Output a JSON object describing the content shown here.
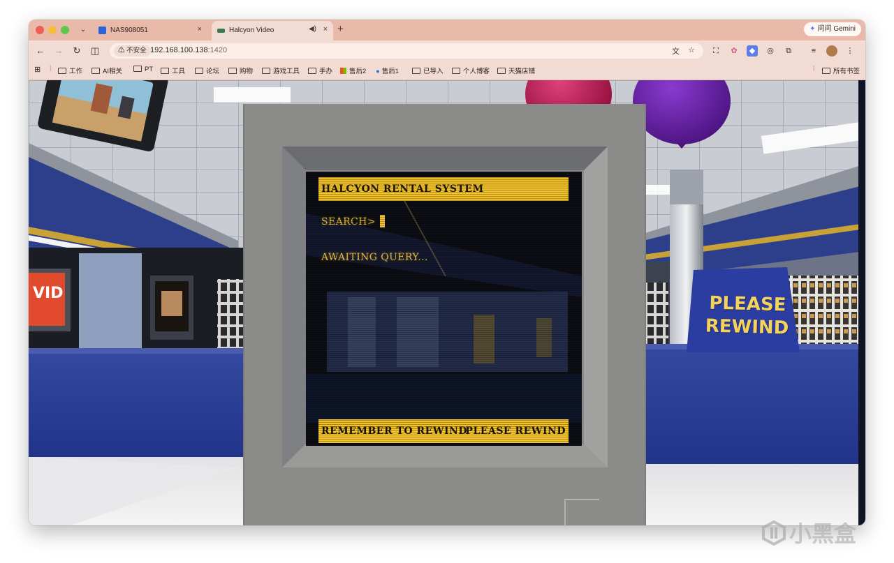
{
  "tabs": [
    {
      "title": "NAS908051",
      "favicon_color": "#2b63d9",
      "active": false,
      "close": "×"
    },
    {
      "title": "Halcyon Video",
      "favicon_color": "#3a7a4a",
      "active": true,
      "close": "×",
      "audio_icon": "speaker-icon"
    }
  ],
  "new_tab_label": "+",
  "tab_list_icon": "chevron-down-icon",
  "gemini_label": "问问 Gemini",
  "nav": {
    "back_icon": "back-arrow-icon",
    "forward_icon": "forward-arrow-icon",
    "reload_icon": "reload-icon",
    "reading_icon": "split-view-icon"
  },
  "omnibox": {
    "security_label": "不安全",
    "url_host": "192.168.100.138",
    "url_port": ":1420"
  },
  "bookmarks": [
    {
      "label": "工作",
      "type": "folder"
    },
    {
      "label": "AI相关",
      "type": "folder"
    },
    {
      "label": "PT",
      "type": "folder"
    },
    {
      "label": "工具",
      "type": "folder"
    },
    {
      "label": "论坛",
      "type": "folder"
    },
    {
      "label": "购物",
      "type": "folder"
    },
    {
      "label": "游戏工具",
      "type": "folder"
    },
    {
      "label": "手办",
      "type": "folder"
    },
    {
      "label": "售后2",
      "type": "site"
    },
    {
      "label": "售后1",
      "type": "site"
    },
    {
      "label": "已导入",
      "type": "folder"
    },
    {
      "label": "个人博客",
      "type": "folder"
    },
    {
      "label": "天猫店铺",
      "type": "folder"
    }
  ],
  "all_bookmarks_label": "所有书签",
  "crt": {
    "header": "HALCYON RENTAL SYSTEM",
    "prompt": "SEARCH>",
    "status": "AWAITING QUERY...",
    "footer_left": "REMEMBER TO REWIND",
    "footer_right": "PLEASE REWIND"
  },
  "sign": {
    "line1": "PLEASE",
    "line2": "REWIND"
  },
  "poster_text": "VID",
  "watermark": "小黑盒",
  "colors": {
    "tab_strip": "#e9b9a9",
    "toolbar": "#f1dbd3",
    "crt_yellow": "#f2c530",
    "counter_blue": "#2a3f9a",
    "sign_yellow": "#f4d35a"
  }
}
